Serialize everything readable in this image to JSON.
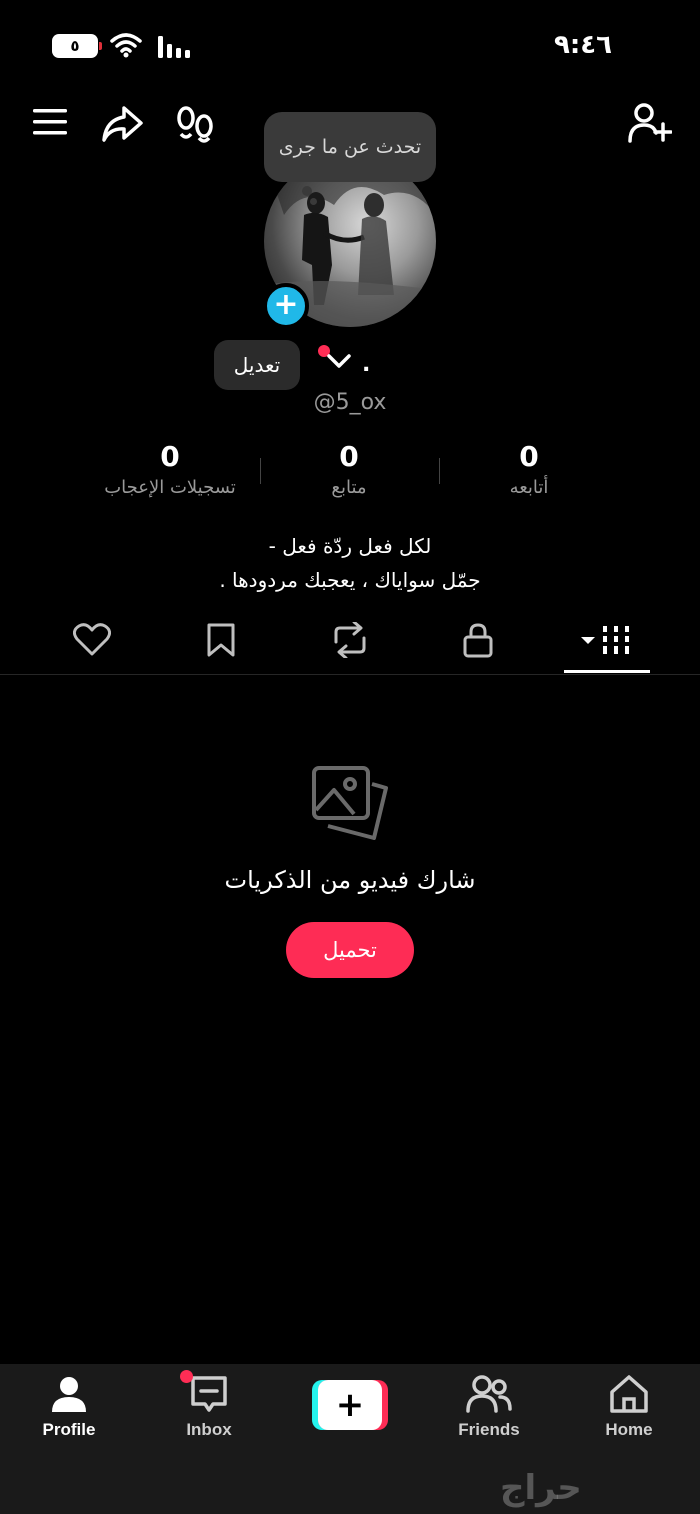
{
  "status_bar": {
    "time": "٩:٤٦",
    "battery": "٥"
  },
  "tooltip": "تحدث عن ما جرى",
  "profile": {
    "edit_label": "تعديل",
    "display_name": ".",
    "username": "@5_ox"
  },
  "stats": [
    {
      "value": "0",
      "label": "تسجيلات الإعجاب"
    },
    {
      "value": "0",
      "label": "متابع"
    },
    {
      "value": "0",
      "label": "أتابعه"
    }
  ],
  "bio": {
    "line1": "لكل فعل ردّة فعل -",
    "line2": "جمّل سواياك ، يعجبك مردودها ."
  },
  "empty_state": {
    "text": "شارك فيديو من الذكريات",
    "button": "تحميل"
  },
  "bottom_nav": {
    "profile": "Profile",
    "inbox": "Inbox",
    "create": "+",
    "friends": "Friends",
    "home": "Home"
  },
  "watermark": "حراج",
  "colors": {
    "accent": "#fe2c55",
    "cyan": "#25f4ee",
    "avatar_plus": "#20b8e8"
  }
}
